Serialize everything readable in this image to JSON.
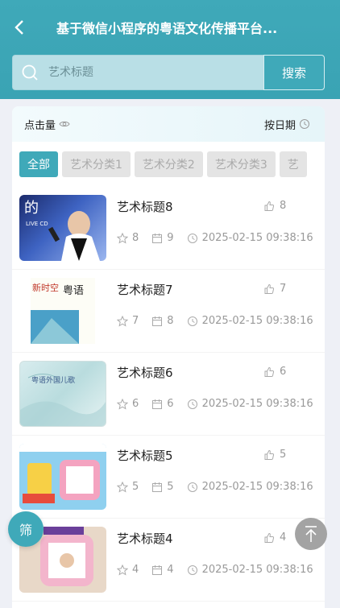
{
  "header": {
    "title": "基于微信小程序的粤语文化传播平台..."
  },
  "search": {
    "placeholder": "艺术标题",
    "button_label": "搜索"
  },
  "sort": {
    "clicks_label": "点击量",
    "date_label": "按日期"
  },
  "categories": [
    {
      "label": "全部",
      "active": true
    },
    {
      "label": "艺术分类1",
      "active": false
    },
    {
      "label": "艺术分类2",
      "active": false
    },
    {
      "label": "艺术分类3",
      "active": false
    },
    {
      "label": "艺",
      "active": false
    }
  ],
  "items": [
    {
      "title": "艺术标题8",
      "likes": "8",
      "favorites": "8",
      "views": "9",
      "time": "2025-02-15 09:38:16"
    },
    {
      "title": "艺术标题7",
      "likes": "7",
      "favorites": "7",
      "views": "8",
      "time": "2025-02-15 09:38:16"
    },
    {
      "title": "艺术标题6",
      "likes": "6",
      "favorites": "6",
      "views": "6",
      "time": "2025-02-15 09:38:16"
    },
    {
      "title": "艺术标题5",
      "likes": "5",
      "favorites": "5",
      "views": "5",
      "time": "2025-02-15 09:38:16"
    },
    {
      "title": "艺术标题4",
      "likes": "4",
      "favorites": "4",
      "views": "4",
      "time": "2025-02-15 09:38:16"
    }
  ],
  "thumbs": [
    {
      "text1": "的",
      "text2": "LIVE CD"
    },
    {
      "text1": "新时空",
      "text2": "粤语"
    },
    {
      "text1": "粤语外国儿歌",
      "text2": ""
    },
    {
      "text1": "",
      "text2": ""
    },
    {
      "text1": "",
      "text2": ""
    }
  ],
  "fab": {
    "filter_label": "筛"
  },
  "colors": {
    "accent": "#3fa9b9",
    "muted": "#999999"
  }
}
